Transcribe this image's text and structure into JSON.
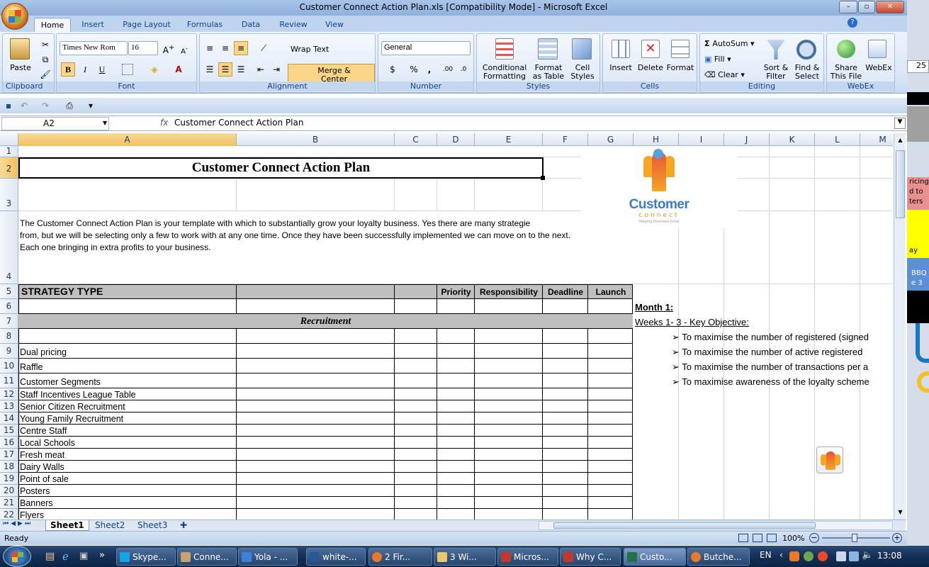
{
  "window": {
    "title": "Customer Connect Action Plan.xls  [Compatibility Mode] - Microsoft Excel"
  },
  "ribbon_tabs": [
    "Home",
    "Insert",
    "Page Layout",
    "Formulas",
    "Data",
    "Review",
    "View"
  ],
  "clipboard": {
    "paste": "Paste",
    "label": "Clipboard"
  },
  "font": {
    "name": "Times New Rom",
    "size": "16",
    "bold": "B",
    "italic": "I",
    "underline": "U",
    "label": "Font"
  },
  "alignment": {
    "wrap": "Wrap Text",
    "merge": "Merge & Center",
    "label": "Alignment"
  },
  "number": {
    "format": "General",
    "percent": "%",
    "comma": ",",
    "label": "Number"
  },
  "styles": {
    "conditional": [
      "Conditional",
      "Formatting"
    ],
    "format_table": [
      "Format",
      "as Table"
    ],
    "cell_styles": [
      "Cell",
      "Styles"
    ],
    "label": "Styles"
  },
  "cells": {
    "insert": "Insert",
    "delete": "Delete",
    "format": "Format",
    "label": "Cells"
  },
  "editing": {
    "autosum": "AutoSum",
    "fill": "Fill",
    "clear": "Clear",
    "sort": [
      "Sort &",
      "Filter"
    ],
    "find": [
      "Find &",
      "Select"
    ],
    "label": "Editing"
  },
  "webex": {
    "share": [
      "Share",
      "This File"
    ],
    "webex": "WebEx",
    "label": "WebEx"
  },
  "formula_bar": {
    "namebox": "A2",
    "fx": "fx",
    "content": "Customer Connect Action Plan"
  },
  "columns": [
    "A",
    "B",
    "C",
    "D",
    "E",
    "F",
    "G",
    "H",
    "I",
    "J",
    "K",
    "L",
    "M"
  ],
  "rows": [
    "1",
    "2",
    "3",
    "4",
    "5",
    "6",
    "7",
    "8",
    "9",
    "10",
    "11",
    "12",
    "13",
    "14",
    "15",
    "16",
    "17",
    "18",
    "19",
    "20",
    "21",
    "22"
  ],
  "sheet": {
    "title": "Customer Connect Action Plan",
    "intro": [
      "The Customer Connect Action Plan is your template with which to substantially grow your loyalty business. Yes there are many strategie",
      "from, but we will be selecting only a few to work with at any one time. Once they have been successfully implemented we can move on to the next.",
      "Each one bringing in extra profits to your business."
    ],
    "header": {
      "strategy": "STRATEGY TYPE",
      "priority": "Priority",
      "responsibility": "Responsibility",
      "deadline": "Deadline",
      "launch": "Launch"
    },
    "section": "Recruitment",
    "items": [
      "Dual pricing",
      "Raffle",
      "Customer Segments",
      "Staff Incentives League Table",
      "Senior Citizen Recruitment",
      "Young Family Recruitment",
      "Centre Staff",
      "Local Schools",
      "Fresh meat",
      "Dairy Walls",
      "Point of sale",
      "Posters",
      "Banners",
      "Flyers"
    ],
    "month": "Month 1:",
    "weeks": "Weeks 1- 3 - Key Objective:",
    "objectives": [
      "To maximise the number of registered (signed",
      "To maximise the number of active registered",
      "To maximise the number of transactions per a",
      "To maximise awareness of the loyalty scheme"
    ],
    "logo_text": "Customer",
    "logo_sub": "connect",
    "logo_tag": "Helping Business Grow"
  },
  "sheet_tabs": [
    "Sheet1",
    "Sheet2",
    "Sheet3"
  ],
  "status": {
    "ready": "Ready",
    "zoom": "100%"
  },
  "taskbar": {
    "items": [
      "Skype...",
      "Conne...",
      "Yola - ...",
      "white-...",
      "2 Fir...",
      "3 Wi...",
      "Micros...",
      "Why C...",
      "Custo...",
      "Butche..."
    ],
    "lang": "EN",
    "time": "13:08"
  },
  "right_strip": {
    "value": "25",
    "texts": [
      "ricing",
      "d to",
      "ters",
      "ay",
      "BBQ",
      "e 3"
    ]
  }
}
